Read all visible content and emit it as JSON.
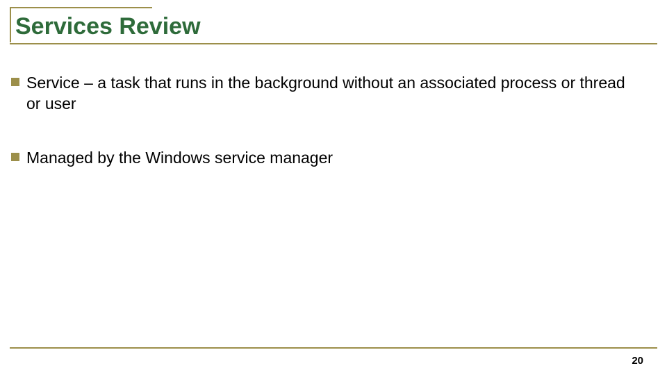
{
  "title": "Services Review",
  "bullets": [
    "Service – a task that runs in the background without an associated process or thread or user",
    "Managed by the Windows service manager"
  ],
  "page_number": "20",
  "colors": {
    "accent": "#9c8f4a",
    "title": "#2e6b3a"
  }
}
